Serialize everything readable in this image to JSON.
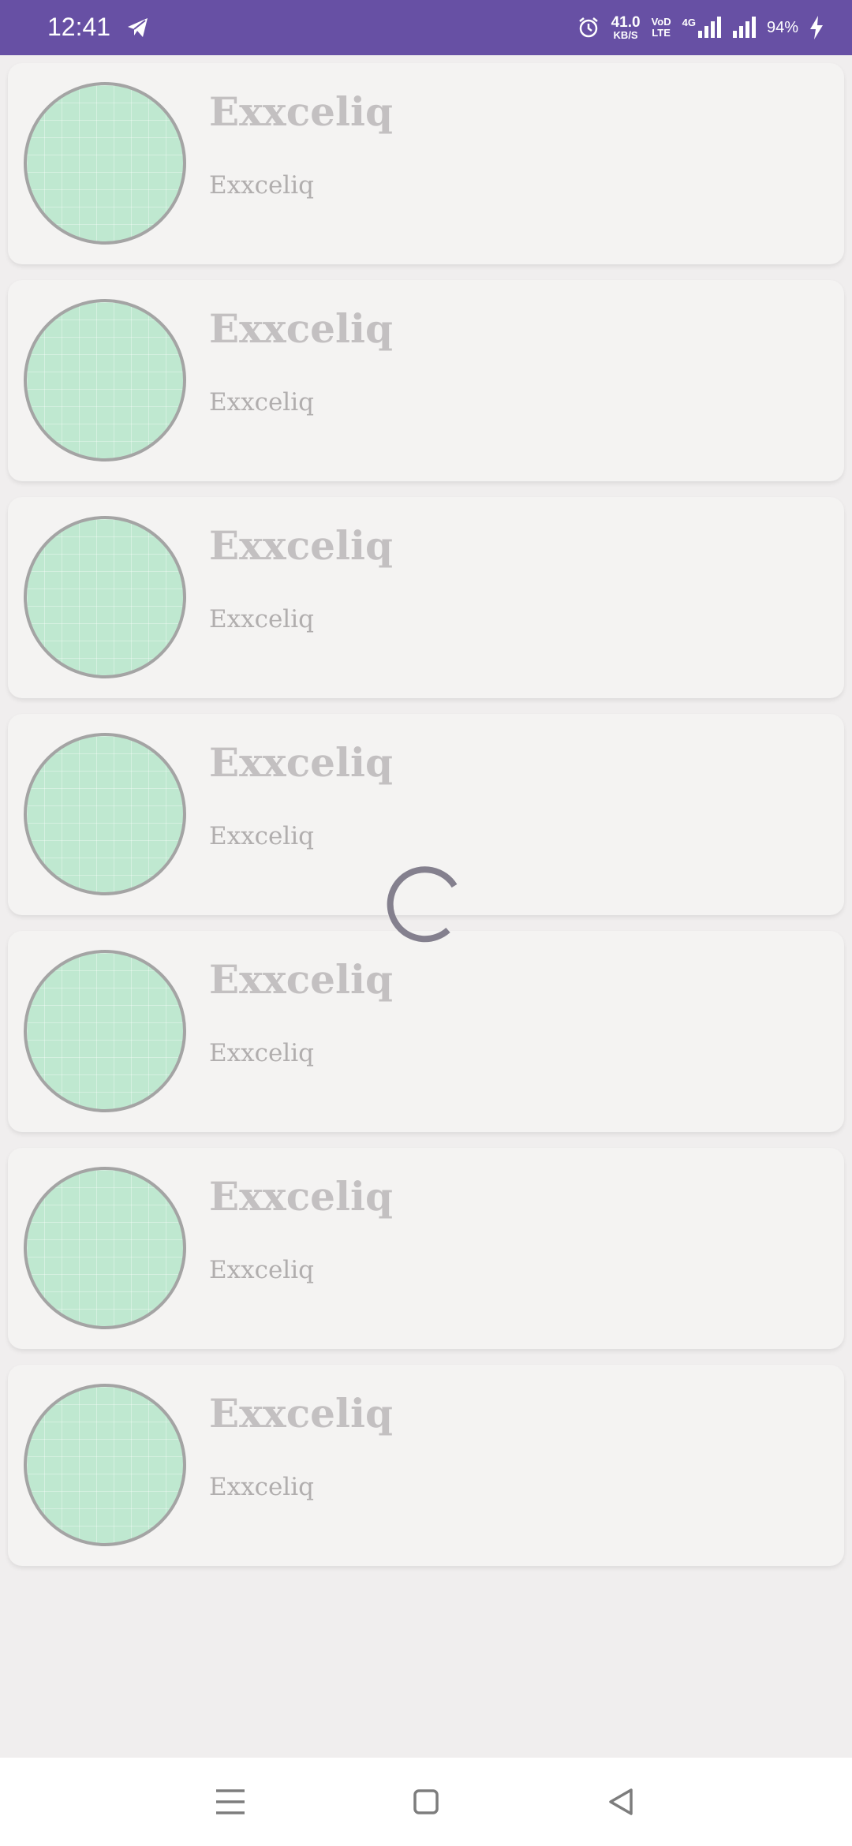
{
  "status_bar": {
    "time": "12:41",
    "net_speed_value": "41.0",
    "net_speed_unit": "KB/S",
    "volte_top": "VoD",
    "volte_bottom": "LTE",
    "network_type": "4G",
    "battery": "94%",
    "icons": [
      "telegram-icon",
      "alarm-icon",
      "signal-icon",
      "signal-icon",
      "charging-icon"
    ]
  },
  "list": {
    "items": [
      {
        "title": "Exxceliq",
        "subtitle": "Exxceliq"
      },
      {
        "title": "Exxceliq",
        "subtitle": "Exxceliq"
      },
      {
        "title": "Exxceliq",
        "subtitle": "Exxceliq"
      },
      {
        "title": "Exxceliq",
        "subtitle": "Exxceliq"
      },
      {
        "title": "Exxceliq",
        "subtitle": "Exxceliq"
      },
      {
        "title": "Exxceliq",
        "subtitle": "Exxceliq"
      },
      {
        "title": "Exxceliq",
        "subtitle": "Exxceliq"
      }
    ]
  },
  "loading": {
    "icon": "loading-spinner-icon"
  },
  "nav_bar": {
    "icons": [
      "menu-icon",
      "home-icon",
      "back-icon"
    ]
  },
  "colors": {
    "status_bar": "#6750a4",
    "card": "#f4f3f2",
    "avatar": "#bfe8d0",
    "title_text": "#c3c0c1",
    "subtitle_text": "#b1aeae"
  }
}
